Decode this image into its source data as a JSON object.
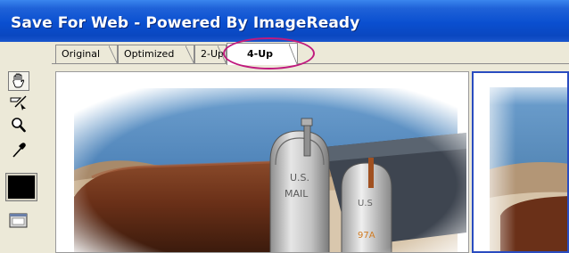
{
  "window": {
    "title": "Save For Web - Powered By ImageReady"
  },
  "tabs": [
    {
      "label": "Original",
      "selected": false
    },
    {
      "label": "Optimized",
      "selected": false
    },
    {
      "label": "2-Up",
      "selected": false
    },
    {
      "label": "4-Up",
      "selected": true
    }
  ],
  "highlight": {
    "target": "4-Up tab",
    "color": "#c01a7e"
  },
  "toolbox": {
    "tools": [
      "hand-icon",
      "slice-select-icon",
      "zoom-icon",
      "eyedropper-icon"
    ],
    "color_swatch": "#000000",
    "preview_tool": "preview-in-browser-icon"
  },
  "preview": {
    "subject": "mailboxes-photo",
    "selected_pane_border": "#2a4cc0"
  }
}
